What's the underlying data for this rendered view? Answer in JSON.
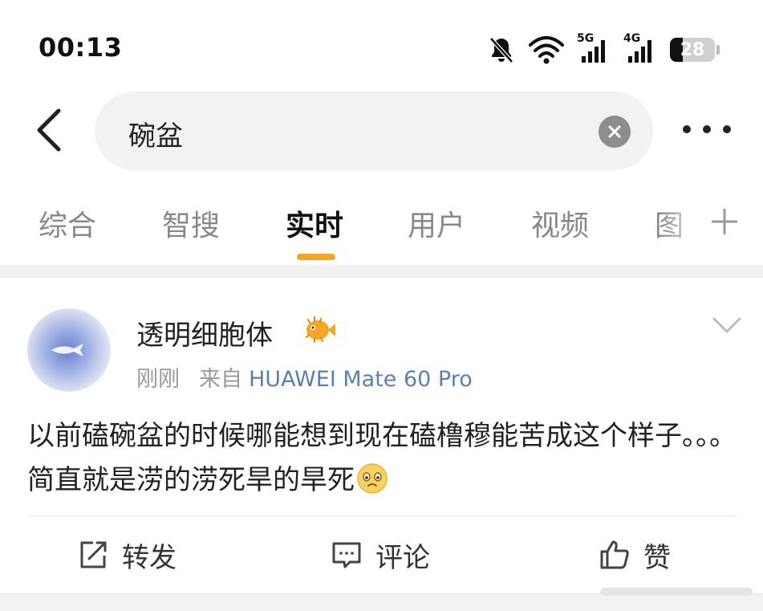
{
  "status_bar": {
    "time": "00:13",
    "network_1": "5G",
    "network_2": "4G",
    "battery": "28",
    "battery_level_pct": 28
  },
  "search": {
    "query": "碗盆"
  },
  "tabs": [
    {
      "label": "综合"
    },
    {
      "label": "智搜"
    },
    {
      "label": "实时"
    },
    {
      "label": "用户"
    },
    {
      "label": "视频"
    },
    {
      "label": "图"
    }
  ],
  "active_tab": "实时",
  "colors": {
    "accent": "#f5a623",
    "link": "#5b7fb0"
  },
  "post": {
    "username": "透明细胞体",
    "time": "刚刚",
    "source_prefix": "来自",
    "source": "HUAWEI Mate 60 Pro",
    "text": "以前磕碗盆的时候哪能想到现在磕橹穆能苦成这个样子。。。简直就是涝的涝死旱的旱死",
    "actions": {
      "repost": "转发",
      "comment": "评论",
      "like": "赞"
    }
  }
}
